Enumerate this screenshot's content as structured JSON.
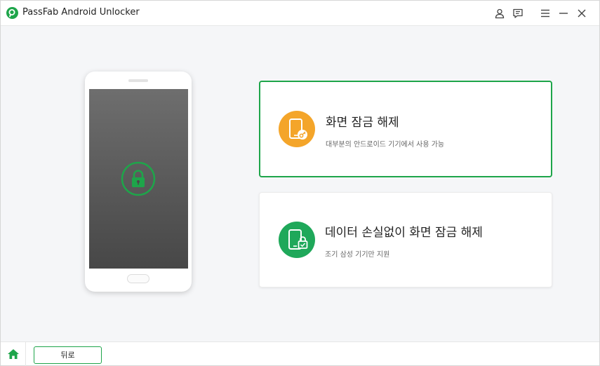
{
  "window": {
    "title": "PassFab Android Unlocker"
  },
  "titlebar": {
    "icons": [
      "account-icon",
      "feedback-icon",
      "menu-icon",
      "minimize-icon",
      "close-icon"
    ]
  },
  "main": {
    "options": [
      {
        "title": "화면 잠금 해제",
        "description": "대부분의 안드로이드 기기에서 사용 가능",
        "icon": "phone-key-icon",
        "icon_color": "#f4a52a",
        "selected": true
      },
      {
        "title": "데이터 손실없이 화면 잠금 해제",
        "description": "조기 삼성 기기만 지원",
        "icon": "phone-lock-icon",
        "icon_color": "#1fa85a",
        "selected": false
      }
    ]
  },
  "footer": {
    "back_label": "뒤로",
    "home_icon": "home-icon"
  },
  "colors": {
    "accent": "#1ea54a",
    "selected_border": "#1ea54a",
    "orange": "#f4a52a"
  }
}
